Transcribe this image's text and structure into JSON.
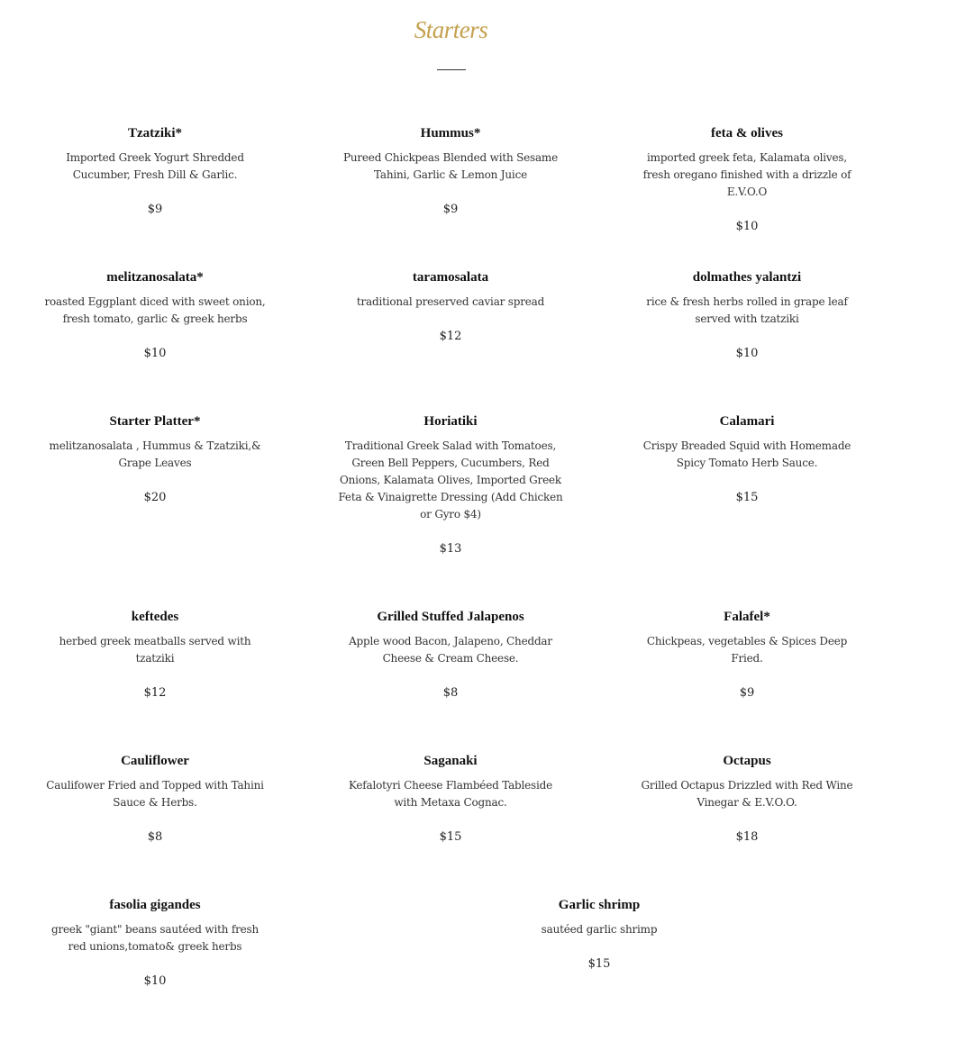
{
  "section": {
    "title": "Starters"
  },
  "items": [
    {
      "name": "Tzatziki*",
      "description": "Imported Greek Yogurt Shredded Cucumber, Fresh Dill & Garlic.",
      "price": "$9"
    },
    {
      "name": "Hummus*",
      "description": "Pureed Chickpeas Blended with Sesame Tahini, Garlic & Lemon Juice",
      "price": "$9"
    },
    {
      "name": "feta & olives",
      "description": "imported greek feta, Kalamata olives, fresh oregano finished with a drizzle of E.V.O.O",
      "price": "$10"
    },
    {
      "name": "melitzanosalata*",
      "description": "roasted Eggplant diced with sweet onion, fresh tomato, garlic & greek herbs",
      "price": "$10"
    },
    {
      "name": "taramosalata",
      "description": "traditional preserved caviar spread",
      "price": "$12"
    },
    {
      "name": "dolmathes yalantzi",
      "description": "rice & fresh herbs rolled in grape leaf served with tzatziki",
      "price": "$10"
    },
    {
      "name": "Starter Platter*",
      "description": "melitzanosalata , Hummus & Tzatziki,& Grape Leaves",
      "price": "$20"
    },
    {
      "name": "Horiatiki",
      "description": "Traditional Greek Salad with Tomatoes, Green Bell Peppers, Cucumbers, Red Onions, Kalamata Olives, Imported Greek Feta & Vinaigrette Dressing (Add Chicken or Gyro $4)",
      "price": "$13"
    },
    {
      "name": "Calamari",
      "description": "Crispy Breaded Squid with Homemade Spicy Tomato Herb Sauce.",
      "price": "$15"
    },
    {
      "name": "keftedes",
      "description": "herbed greek meatballs served with tzatziki",
      "price": "$12"
    },
    {
      "name": "Grilled Stuffed Jalapenos",
      "description": "Apple wood Bacon, Jalapeno, Cheddar Cheese & Cream Cheese.",
      "price": "$8"
    },
    {
      "name": "Falafel*",
      "description": "Chickpeas, vegetables & Spices Deep Fried.",
      "price": "$9"
    },
    {
      "name": "Cauliflower",
      "description": "Caulifower Fried and Topped with Tahini Sauce & Herbs.",
      "price": "$8"
    },
    {
      "name": "Saganaki",
      "description": "Kefalotyri Cheese Flambéed Tableside with Metaxa Cognac.",
      "price": "$15"
    },
    {
      "name": "Octapus",
      "description": "Grilled Octapus Drizzled with Red Wine Vinegar & E.V.O.O.",
      "price": "$18"
    },
    {
      "name": "fasolia gigandes",
      "description": "greek \"giant\" beans sautéed with fresh red unions,tomato& greek herbs",
      "price": "$10"
    },
    {
      "name": "Garlic shrimp",
      "description": "sautéed garlic shrimp",
      "price": "$15"
    }
  ]
}
